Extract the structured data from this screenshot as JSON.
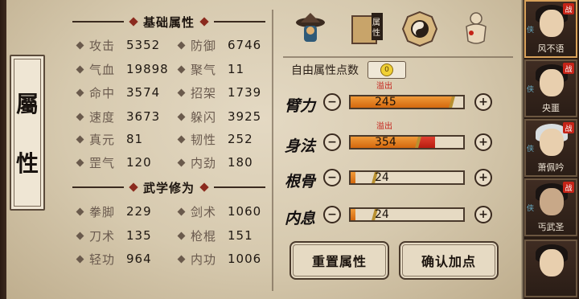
{
  "side_tab": {
    "chars": [
      "屬",
      "性"
    ]
  },
  "basic_section": {
    "title": "基础属性"
  },
  "basic_stats": [
    {
      "name": "攻击",
      "value": "5352"
    },
    {
      "name": "防御",
      "value": "6746"
    },
    {
      "name": "气血",
      "value": "19898"
    },
    {
      "name": "聚气",
      "value": "11"
    },
    {
      "name": "命中",
      "value": "3574"
    },
    {
      "name": "招架",
      "value": "1739"
    },
    {
      "name": "速度",
      "value": "3673"
    },
    {
      "name": "躲闪",
      "value": "3925"
    },
    {
      "name": "真元",
      "value": "81"
    },
    {
      "name": "韧性",
      "value": "252"
    },
    {
      "name": "罡气",
      "value": "120"
    },
    {
      "name": "内劲",
      "value": "180"
    }
  ],
  "martial_section": {
    "title": "武学修为"
  },
  "martial_stats": [
    {
      "name": "拳脚",
      "value": "229"
    },
    {
      "name": "剑术",
      "value": "1060"
    },
    {
      "name": "刀术",
      "value": "135"
    },
    {
      "name": "枪棍",
      "value": "151"
    },
    {
      "name": "轻功",
      "value": "964"
    },
    {
      "name": "内功",
      "value": "1006"
    }
  ],
  "tabs": [
    {
      "icon": "hat-figure-icon"
    },
    {
      "icon": "scroll-attribute-icon",
      "label": "属性"
    },
    {
      "icon": "bagua-icon"
    },
    {
      "icon": "body-figure-icon"
    }
  ],
  "free_points": {
    "label": "自由属性点数",
    "value": "0"
  },
  "attributes": [
    {
      "name": "臂力",
      "value": "245",
      "overflow_label": "溢出",
      "fill": 0.9,
      "over": 0.0
    },
    {
      "name": "身法",
      "value": "354",
      "overflow_label": "溢出",
      "fill": 0.6,
      "over": 0.15
    },
    {
      "name": "根骨",
      "value": "24",
      "overflow_label": "",
      "fill": 0.04,
      "over": 0.0
    },
    {
      "name": "内息",
      "value": "24",
      "overflow_label": "",
      "fill": 0.04,
      "over": 0.0
    }
  ],
  "buttons": {
    "reset": "重置属性",
    "confirm": "确认加点"
  },
  "characters": [
    {
      "name": "风不语",
      "badge": "战",
      "tag": "侠",
      "active": true
    },
    {
      "name": "央噩",
      "badge": "战",
      "tag": "侠",
      "active": false
    },
    {
      "name": "萧佩吟",
      "badge": "战",
      "tag": "侠",
      "active": false
    },
    {
      "name": "丐武圣",
      "badge": "战",
      "tag": "侠",
      "active": false
    },
    {
      "name": "",
      "badge": "",
      "tag": "",
      "active": false
    }
  ],
  "colors": {
    "bar_fill": "#e27a1e",
    "bar_overflow": "#c4201a",
    "accent_red": "#8b2a1e"
  }
}
